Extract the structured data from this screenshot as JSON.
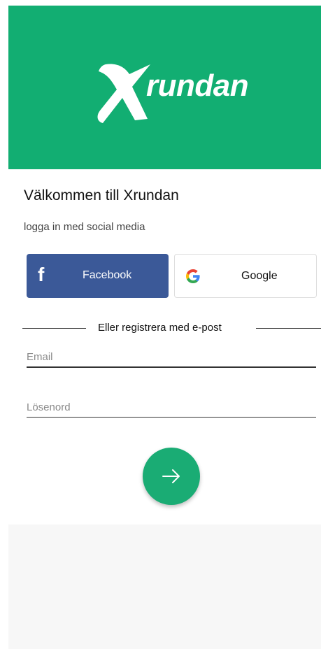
{
  "brand": {
    "name": "Xrundan",
    "logo_word": "rundan",
    "primary_color": "#12ae72",
    "facebook_color": "#3b5998"
  },
  "welcome": {
    "title": "Välkommen till Xrundan",
    "subtitle": "logga in med social media"
  },
  "social": {
    "facebook_label": "Facebook",
    "facebook_icon": "facebook-icon",
    "google_label": "Google",
    "google_icon": "google-icon"
  },
  "divider_text": "Eller registrera med e-post",
  "form": {
    "email_placeholder": "Email",
    "email_value": "",
    "password_placeholder": "Lösenord",
    "password_value": ""
  },
  "submit_icon": "arrow-right-icon"
}
